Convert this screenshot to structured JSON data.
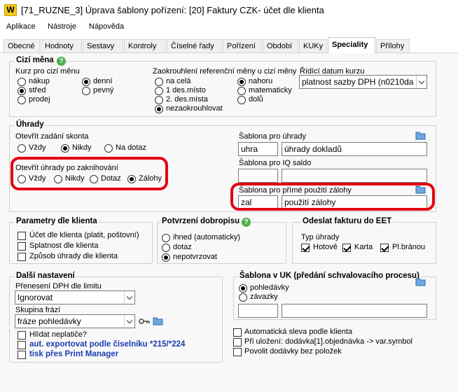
{
  "window": {
    "title": "[71_RUZNE_3] Úprava šablony pořízení: [20] Faktury CZK- účet dle klienta",
    "logo": "W"
  },
  "menu": [
    "Aplikace",
    "Nástroje",
    "Nápověda"
  ],
  "tabs": [
    "Obecné",
    "Hodnoty",
    "Sestavy",
    "Kontroly",
    "Číselné řady",
    "Pořízení",
    "Období",
    "KUKy",
    "Speciality",
    "Přílohy"
  ],
  "active_tab": "Speciality",
  "cizi_mena": {
    "title": "Cizí měna",
    "kurz_label": "Kurz pro cizí měnu",
    "kurz_options": [
      "nákup",
      "střed",
      "prodej",
      "denní",
      "pevný"
    ],
    "kurz_selected": [
      "střed",
      "denní"
    ],
    "zaokr_label": "Zaokrouhlení referenční měny u cizí měny",
    "zaokr_options": [
      "na celá",
      "1 des.místo",
      "2. des.místa",
      "nezaokrouhlovat"
    ],
    "zaokr_selected": "nezaokrouhlovat",
    "smer_options": [
      "nahoru",
      "matematicky",
      "dolů"
    ],
    "smer_selected": "nahoru",
    "datum_label": "Řídící datum kurzu",
    "datum_value": "platnost sazby DPH (n0210da"
  },
  "uhrady": {
    "title": "Úhrady",
    "skonto_label": "Otevřít zadání skonta",
    "skonto_options": [
      "Vždy",
      "Nikdy",
      "Na dotaz"
    ],
    "skonto_selected": "Nikdy",
    "zaknih_label": "Otevřít úhrady po zaknihování",
    "zaknih_options": [
      "Vždy",
      "Nikdy",
      "Dotaz",
      "Zálohy"
    ],
    "zaknih_selected": "Zálohy",
    "sablona_label": "Šablona pro úhrady",
    "sablona_code": "uhra",
    "sablona_name": "úhrady dokladů",
    "iq_label": "Šablona pro IQ saldo",
    "iq_code": "",
    "iq_name": "",
    "zal_label": "Šablona pro přímé použití zálohy",
    "zal_code": "zal",
    "zal_name": "použití zálohy"
  },
  "parametry": {
    "title": "Parametry dle klienta",
    "items": [
      "Účet dle klienta (platit, poštovní)",
      "Splatnost dle klienta",
      "Způsob úhrady dle klienta"
    ]
  },
  "dobropis": {
    "title": "Potvrzení dobropisu",
    "options": [
      "ihned (automaticky)",
      "dotaz",
      "nepotvrzovat"
    ],
    "selected": "nepotvrzovat"
  },
  "eet": {
    "title": "Odeslat fakturu do EET",
    "typ_label": "Typ úhrady",
    "items": [
      "Hotově",
      "Karta",
      "Pl.bránou"
    ]
  },
  "dalsi": {
    "title": "Další nastavení",
    "dph_label": "Přenesení DPH dle limitu",
    "dph_value": "Ignorovat",
    "fraze_label": "Skupina frází",
    "fraze_value": "fráze pohledávky",
    "hlidat": "Hlídat neplatiče?",
    "export": "aut. exportovat podle číselníku *215/*224",
    "tisk": "tisk přes Print Manager"
  },
  "uk": {
    "title": "Šablona v UK (předání schvalovacího procesu)",
    "options": [
      "pohledávky",
      "závazky"
    ],
    "selected": "pohledávky",
    "code": "",
    "name": ""
  },
  "extra": [
    "Automatická sleva podle klienta",
    "Při uložení: dodávka[1].objednávka -> var.symbol",
    "Povolit dodávky bez položek"
  ],
  "colors": {
    "highlight": "#e30613",
    "help": "#4caf50",
    "link": "#1a3cb0",
    "logo": "#f3c81a"
  }
}
